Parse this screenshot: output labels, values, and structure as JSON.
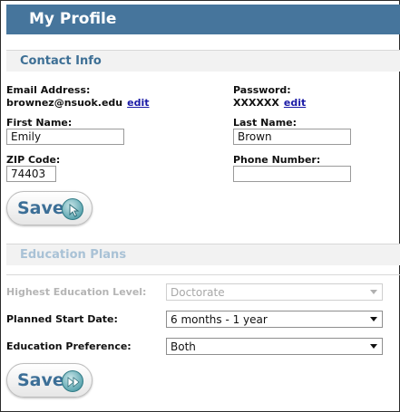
{
  "header": {
    "title": "My Profile"
  },
  "contact": {
    "section_title": "Contact Info",
    "email_label": "Email Address:",
    "email_value": "brownez@nsuok.edu",
    "email_edit": "edit",
    "password_label": "Password:",
    "password_value": "XXXXXX",
    "password_edit": "edit",
    "first_name_label": "First Name:",
    "first_name_value": "Emily",
    "last_name_label": "Last Name:",
    "last_name_value": "Brown",
    "zip_label": "ZIP Code:",
    "zip_value": "74403",
    "phone_label": "Phone Number:",
    "phone_value": "",
    "save_label": "Save"
  },
  "education": {
    "section_title": "Education Plans",
    "highest_level_label": "Highest Education Level:",
    "highest_level_value": "Doctorate",
    "start_date_label": "Planned Start Date:",
    "start_date_value": "6 months - 1 year",
    "preference_label": "Education Preference:",
    "preference_value": "Both",
    "save_label": "Save"
  },
  "colors": {
    "header_bg": "#46759c",
    "section_title": "#3d6f95",
    "link": "#1a1aa6"
  },
  "icons": {
    "save_icon_1": "arrow-cursor-icon",
    "save_icon_2": "fast-forward-icon"
  }
}
